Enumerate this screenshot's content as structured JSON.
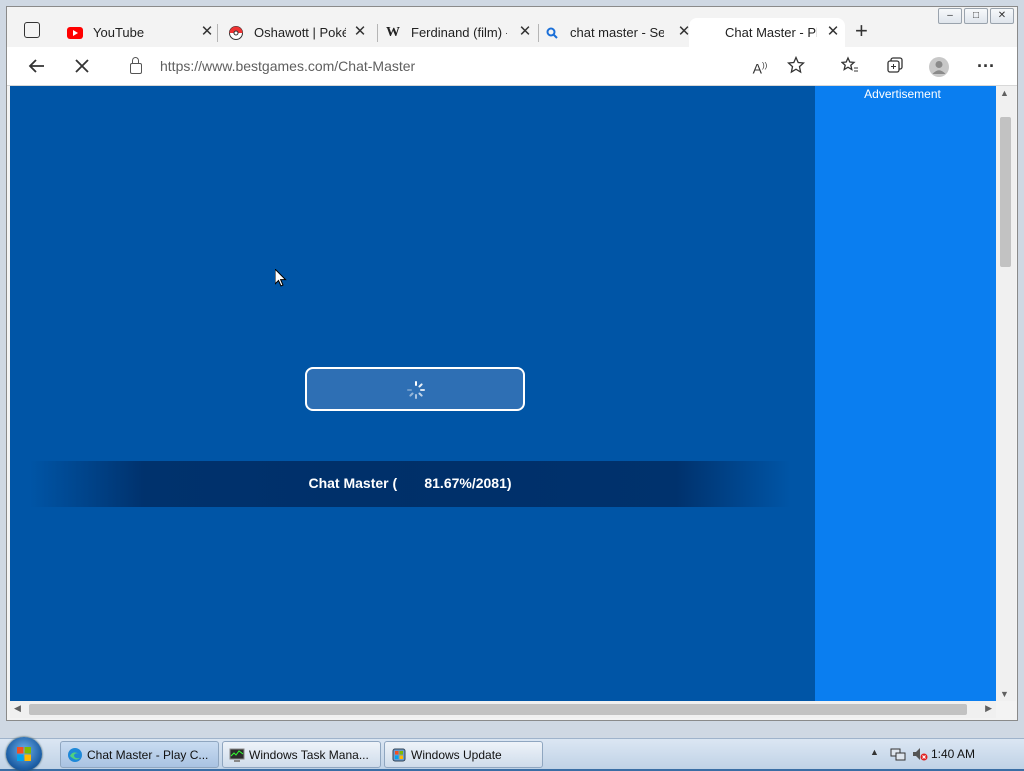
{
  "browser": {
    "tabs": [
      {
        "title": "YouTube",
        "icon": "youtube-icon"
      },
      {
        "title": "Oshawott | Pokémon Wiki",
        "icon": "pokeball-icon"
      },
      {
        "title": "Ferdinand (film) - Wikipedia",
        "icon": "wikipedia-icon"
      },
      {
        "title": "chat master - Search",
        "icon": "search-icon"
      },
      {
        "title": "Chat Master - Play Chat Master",
        "icon": "page-icon",
        "active": true
      }
    ],
    "url": "https://www.bestgames.com/Chat-Master"
  },
  "page": {
    "ad_label": "Advertisement",
    "progress_text": "Chat Master (       81.67%/2081)",
    "background_color": "#0055a6",
    "ad_color": "#0a7ef0"
  },
  "taskbar": {
    "items": [
      {
        "label": "Chat Master - Play C...",
        "icon": "edge-icon",
        "active": true
      },
      {
        "label": "Windows Task Mana...",
        "icon": "task-manager-icon"
      },
      {
        "label": "Windows Update",
        "icon": "windows-update-icon"
      }
    ],
    "clock": "1:40 AM"
  }
}
